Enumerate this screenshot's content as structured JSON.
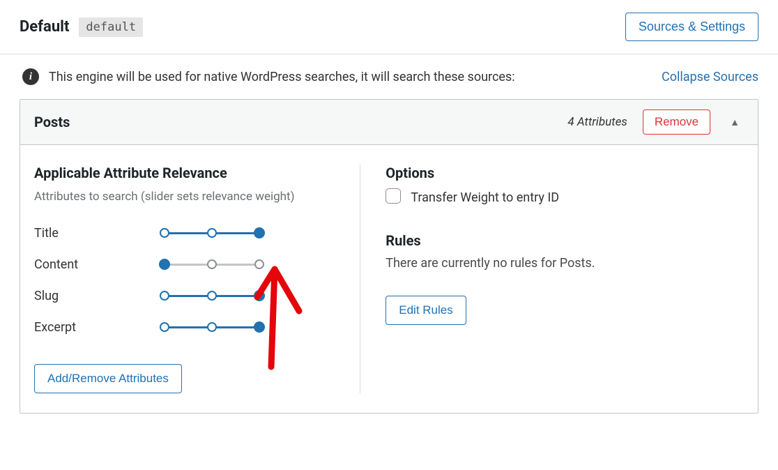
{
  "header": {
    "engine_name": "Default",
    "engine_slug": "default",
    "settings_button": "Sources & Settings"
  },
  "info": {
    "text": "This engine will be used for native WordPress searches, it will search these sources:",
    "collapse_link": "Collapse Sources"
  },
  "panel": {
    "title": "Posts",
    "attribute_count": "4 Attributes",
    "remove_button": "Remove"
  },
  "attributes_section": {
    "heading": "Applicable Attribute Relevance",
    "subtext": "Attributes to search (slider sets relevance weight)",
    "rows": [
      {
        "label": "Title",
        "value": 2
      },
      {
        "label": "Content",
        "value": 0
      },
      {
        "label": "Slug",
        "value": 2
      },
      {
        "label": "Excerpt",
        "value": 2
      }
    ],
    "add_remove_button": "Add/Remove Attributes"
  },
  "options_section": {
    "heading": "Options",
    "transfer_weight_label": "Transfer Weight to entry ID"
  },
  "rules_section": {
    "heading": "Rules",
    "empty_text": "There are currently no rules for Posts.",
    "edit_button": "Edit Rules"
  }
}
